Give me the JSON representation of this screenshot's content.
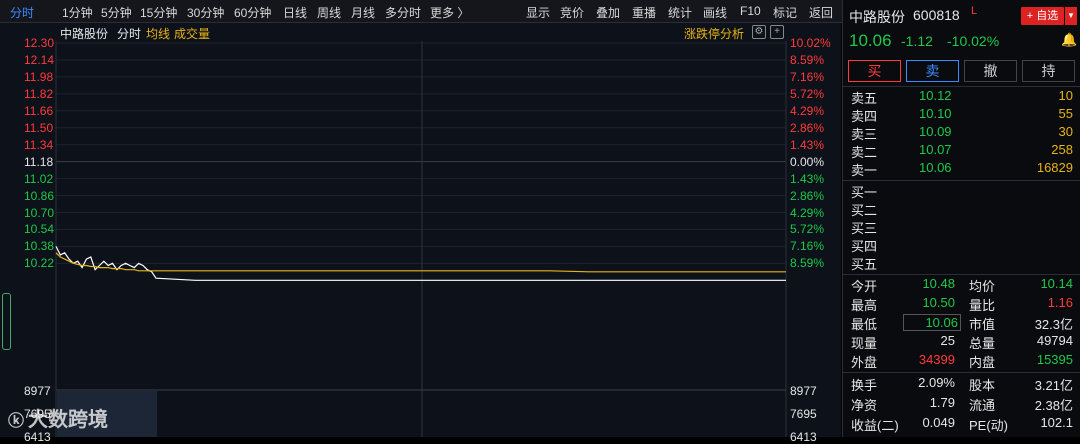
{
  "toolbar": {
    "left_items": [
      "分时",
      "1分钟",
      "5分钟",
      "15分钟",
      "30分钟",
      "60分钟",
      "日线",
      "周线",
      "月线",
      "多分时",
      "更多 〉"
    ],
    "right_items": [
      "显示",
      "竞价",
      "叠加",
      "重播",
      "统计",
      "画线",
      "F10",
      "标记",
      "返回"
    ]
  },
  "chart": {
    "header_name": "中路股份",
    "header_mode": "分时",
    "avg_label": "均线",
    "vol_label": "成交量",
    "limit_label": "涨跌停分析",
    "left_prices": [
      "12.30",
      "12.14",
      "11.98",
      "11.82",
      "11.66",
      "11.50",
      "11.34",
      "11.18",
      "11.02",
      "10.86",
      "10.70",
      "10.54",
      "10.38",
      "10.22"
    ],
    "right_pcts": [
      "10.02%",
      "8.59%",
      "7.16%",
      "5.72%",
      "4.29%",
      "2.86%",
      "1.43%",
      "0.00%",
      "1.43%",
      "2.86%",
      "4.29%",
      "5.72%",
      "7.16%",
      "8.59%"
    ],
    "vol_left": [
      "8977",
      "7695",
      "6413"
    ],
    "vol_right": [
      "8977",
      "7695",
      "6413"
    ],
    "watermark": "大数跨境",
    "colors": {
      "up": "#ff3b3b",
      "down": "#1ec94a",
      "avg": "#e7b416",
      "price": "#ffffff"
    }
  },
  "chart_data": {
    "type": "line",
    "series": [
      {
        "name": "分时",
        "values": [
          10.38,
          10.3,
          10.32,
          10.26,
          10.22,
          10.24,
          10.18,
          10.26,
          10.28,
          10.16,
          10.2,
          10.24,
          10.2,
          10.22,
          10.16,
          10.2,
          10.22,
          10.2,
          10.18,
          10.22,
          10.2,
          10.16,
          10.14,
          10.08,
          10.06,
          10.06,
          10.06,
          10.06,
          10.06,
          10.06,
          10.06,
          10.06,
          10.06,
          10.06,
          10.06,
          10.06,
          10.06,
          10.06,
          10.06,
          10.06
        ]
      },
      {
        "name": "均线",
        "values": [
          10.32,
          10.28,
          10.26,
          10.24,
          10.22,
          10.21,
          10.2,
          10.2,
          10.19,
          10.19,
          10.18,
          10.18,
          10.18,
          10.17,
          10.17,
          10.17,
          10.16,
          10.16,
          10.16,
          10.15,
          10.15,
          10.15,
          10.15,
          10.15,
          10.15,
          10.15,
          10.15,
          10.15,
          10.15,
          10.15,
          10.15,
          10.15,
          10.15,
          10.15,
          10.14,
          10.14,
          10.14,
          10.14,
          10.14,
          10.14
        ]
      }
    ],
    "ylim": [
      10.06,
      12.3
    ],
    "ylabel": "",
    "xlabel": ""
  },
  "quote": {
    "name": "中路股份",
    "code": "600818",
    "tag": "L",
    "add_label": "+ 自选",
    "price": "10.06",
    "change": "-1.12",
    "pct": "-10.02%",
    "buy_btn": "买",
    "sell_btn": "卖",
    "cancel_btn": "撤",
    "hold_btn": "持"
  },
  "sell_orders": [
    {
      "label": "卖五",
      "price": "10.12",
      "vol": "10"
    },
    {
      "label": "卖四",
      "price": "10.10",
      "vol": "55"
    },
    {
      "label": "卖三",
      "price": "10.09",
      "vol": "30"
    },
    {
      "label": "卖二",
      "price": "10.07",
      "vol": "258"
    },
    {
      "label": "卖一",
      "price": "10.06",
      "vol": "16829"
    }
  ],
  "buy_orders": [
    {
      "label": "买一"
    },
    {
      "label": "买二"
    },
    {
      "label": "买三"
    },
    {
      "label": "买四"
    },
    {
      "label": "买五"
    }
  ],
  "stats": [
    {
      "l1": "今开",
      "v1": "10.48",
      "c1": "green",
      "l2": "均价",
      "v2": "10.14",
      "c2": "green"
    },
    {
      "l1": "最高",
      "v1": "10.50",
      "c1": "green",
      "l2": "量比",
      "v2": "1.16",
      "c2": "red"
    },
    {
      "l1": "最低",
      "v1": "10.06",
      "c1": "green",
      "l2": "市值",
      "v2": "32.3亿",
      "c2": "white"
    },
    {
      "l1": "现量",
      "v1": "25",
      "c1": "white",
      "l2": "总量",
      "v2": "49794",
      "c2": "white"
    },
    {
      "l1": "外盘",
      "v1": "34399",
      "c1": "red",
      "l2": "内盘",
      "v2": "15395",
      "c2": "green"
    }
  ],
  "stats2": [
    {
      "l1": "换手",
      "v1": "2.09%",
      "l2": "股本",
      "v2": "3.21亿"
    },
    {
      "l1": "净资",
      "v1": "1.79",
      "l2": "流通",
      "v2": "2.38亿"
    },
    {
      "l1": "收益(二)",
      "v1": "0.049",
      "l2": "PE(动)",
      "v2": "102.1"
    }
  ]
}
